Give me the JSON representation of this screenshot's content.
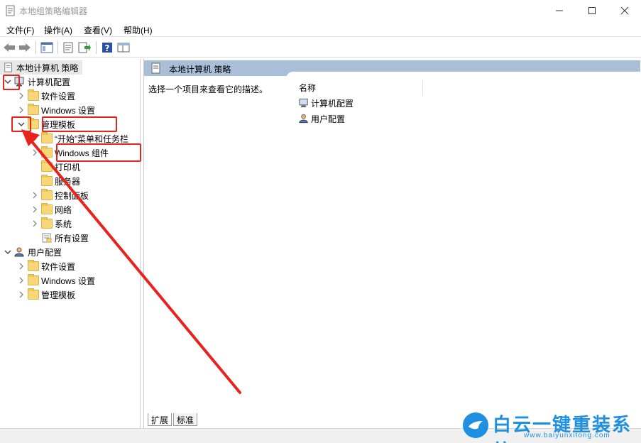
{
  "window": {
    "title": "本地组策略编辑器",
    "controls": {
      "minimize": "—",
      "maximize": "☐",
      "close": "✕"
    }
  },
  "menu": [
    "文件(F)",
    "操作(A)",
    "查看(V)",
    "帮助(H)"
  ],
  "toolbar": {
    "icons": [
      "back-arrow-icon",
      "forward-arrow-icon",
      "show-tree-icon",
      "properties-icon",
      "export-list-icon",
      "help-icon",
      "extended-view-icon"
    ]
  },
  "tree": {
    "root": "本地计算机 策略",
    "computer_config": "计算机配置",
    "computer_children": {
      "software": "软件设置",
      "windows": "Windows 设置",
      "admin": "管理模板"
    },
    "admin_children": {
      "start_menu": "“开始”菜单和任务栏",
      "win_components": "Windows 组件",
      "printers": "打印机",
      "server": "服务器",
      "control_panel": "控制面板",
      "network": "网络",
      "system": "系统",
      "all_settings": "所有设置"
    },
    "user_config": "用户配置",
    "user_children": {
      "software": "软件设置",
      "windows": "Windows 设置",
      "admin": "管理模板"
    }
  },
  "right": {
    "header": "本地计算机 策略",
    "description": "选择一个项目来查看它的描述。",
    "column_name": "名称",
    "items": [
      "计算机配置",
      "用户配置"
    ]
  },
  "tabs": [
    "扩展",
    "标准"
  ],
  "annotation_color": "#e8231d",
  "watermark": {
    "title": "白云一键重装系统",
    "url": "www.baiyunxitong.com",
    "color": "#1e8fe1"
  }
}
